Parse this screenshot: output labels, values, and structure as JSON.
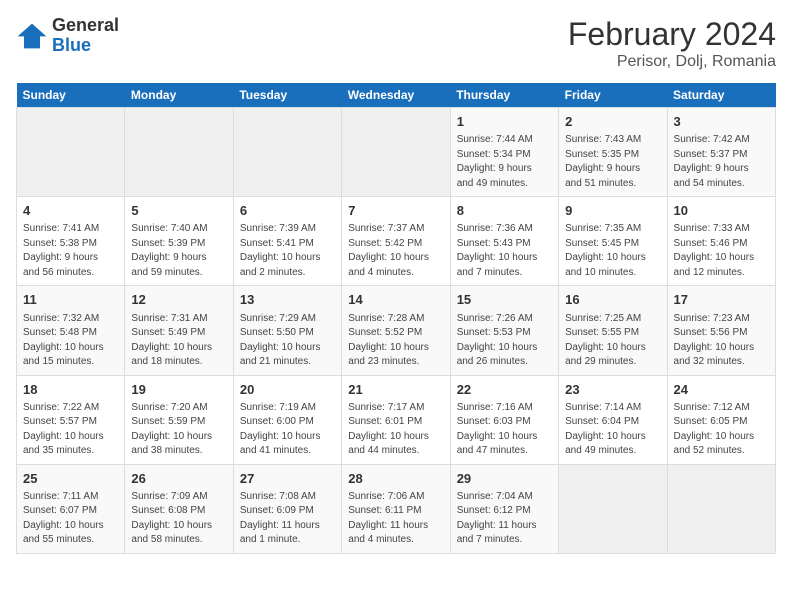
{
  "logo": {
    "text_general": "General",
    "text_blue": "Blue"
  },
  "title": "February 2024",
  "subtitle": "Perisor, Dolj, Romania",
  "days_of_week": [
    "Sunday",
    "Monday",
    "Tuesday",
    "Wednesday",
    "Thursday",
    "Friday",
    "Saturday"
  ],
  "weeks": [
    [
      {
        "day": "",
        "info": ""
      },
      {
        "day": "",
        "info": ""
      },
      {
        "day": "",
        "info": ""
      },
      {
        "day": "",
        "info": ""
      },
      {
        "day": "1",
        "info": "Sunrise: 7:44 AM\nSunset: 5:34 PM\nDaylight: 9 hours\nand 49 minutes."
      },
      {
        "day": "2",
        "info": "Sunrise: 7:43 AM\nSunset: 5:35 PM\nDaylight: 9 hours\nand 51 minutes."
      },
      {
        "day": "3",
        "info": "Sunrise: 7:42 AM\nSunset: 5:37 PM\nDaylight: 9 hours\nand 54 minutes."
      }
    ],
    [
      {
        "day": "4",
        "info": "Sunrise: 7:41 AM\nSunset: 5:38 PM\nDaylight: 9 hours\nand 56 minutes."
      },
      {
        "day": "5",
        "info": "Sunrise: 7:40 AM\nSunset: 5:39 PM\nDaylight: 9 hours\nand 59 minutes."
      },
      {
        "day": "6",
        "info": "Sunrise: 7:39 AM\nSunset: 5:41 PM\nDaylight: 10 hours\nand 2 minutes."
      },
      {
        "day": "7",
        "info": "Sunrise: 7:37 AM\nSunset: 5:42 PM\nDaylight: 10 hours\nand 4 minutes."
      },
      {
        "day": "8",
        "info": "Sunrise: 7:36 AM\nSunset: 5:43 PM\nDaylight: 10 hours\nand 7 minutes."
      },
      {
        "day": "9",
        "info": "Sunrise: 7:35 AM\nSunset: 5:45 PM\nDaylight: 10 hours\nand 10 minutes."
      },
      {
        "day": "10",
        "info": "Sunrise: 7:33 AM\nSunset: 5:46 PM\nDaylight: 10 hours\nand 12 minutes."
      }
    ],
    [
      {
        "day": "11",
        "info": "Sunrise: 7:32 AM\nSunset: 5:48 PM\nDaylight: 10 hours\nand 15 minutes."
      },
      {
        "day": "12",
        "info": "Sunrise: 7:31 AM\nSunset: 5:49 PM\nDaylight: 10 hours\nand 18 minutes."
      },
      {
        "day": "13",
        "info": "Sunrise: 7:29 AM\nSunset: 5:50 PM\nDaylight: 10 hours\nand 21 minutes."
      },
      {
        "day": "14",
        "info": "Sunrise: 7:28 AM\nSunset: 5:52 PM\nDaylight: 10 hours\nand 23 minutes."
      },
      {
        "day": "15",
        "info": "Sunrise: 7:26 AM\nSunset: 5:53 PM\nDaylight: 10 hours\nand 26 minutes."
      },
      {
        "day": "16",
        "info": "Sunrise: 7:25 AM\nSunset: 5:55 PM\nDaylight: 10 hours\nand 29 minutes."
      },
      {
        "day": "17",
        "info": "Sunrise: 7:23 AM\nSunset: 5:56 PM\nDaylight: 10 hours\nand 32 minutes."
      }
    ],
    [
      {
        "day": "18",
        "info": "Sunrise: 7:22 AM\nSunset: 5:57 PM\nDaylight: 10 hours\nand 35 minutes."
      },
      {
        "day": "19",
        "info": "Sunrise: 7:20 AM\nSunset: 5:59 PM\nDaylight: 10 hours\nand 38 minutes."
      },
      {
        "day": "20",
        "info": "Sunrise: 7:19 AM\nSunset: 6:00 PM\nDaylight: 10 hours\nand 41 minutes."
      },
      {
        "day": "21",
        "info": "Sunrise: 7:17 AM\nSunset: 6:01 PM\nDaylight: 10 hours\nand 44 minutes."
      },
      {
        "day": "22",
        "info": "Sunrise: 7:16 AM\nSunset: 6:03 PM\nDaylight: 10 hours\nand 47 minutes."
      },
      {
        "day": "23",
        "info": "Sunrise: 7:14 AM\nSunset: 6:04 PM\nDaylight: 10 hours\nand 49 minutes."
      },
      {
        "day": "24",
        "info": "Sunrise: 7:12 AM\nSunset: 6:05 PM\nDaylight: 10 hours\nand 52 minutes."
      }
    ],
    [
      {
        "day": "25",
        "info": "Sunrise: 7:11 AM\nSunset: 6:07 PM\nDaylight: 10 hours\nand 55 minutes."
      },
      {
        "day": "26",
        "info": "Sunrise: 7:09 AM\nSunset: 6:08 PM\nDaylight: 10 hours\nand 58 minutes."
      },
      {
        "day": "27",
        "info": "Sunrise: 7:08 AM\nSunset: 6:09 PM\nDaylight: 11 hours\nand 1 minute."
      },
      {
        "day": "28",
        "info": "Sunrise: 7:06 AM\nSunset: 6:11 PM\nDaylight: 11 hours\nand 4 minutes."
      },
      {
        "day": "29",
        "info": "Sunrise: 7:04 AM\nSunset: 6:12 PM\nDaylight: 11 hours\nand 7 minutes."
      },
      {
        "day": "",
        "info": ""
      },
      {
        "day": "",
        "info": ""
      }
    ]
  ]
}
